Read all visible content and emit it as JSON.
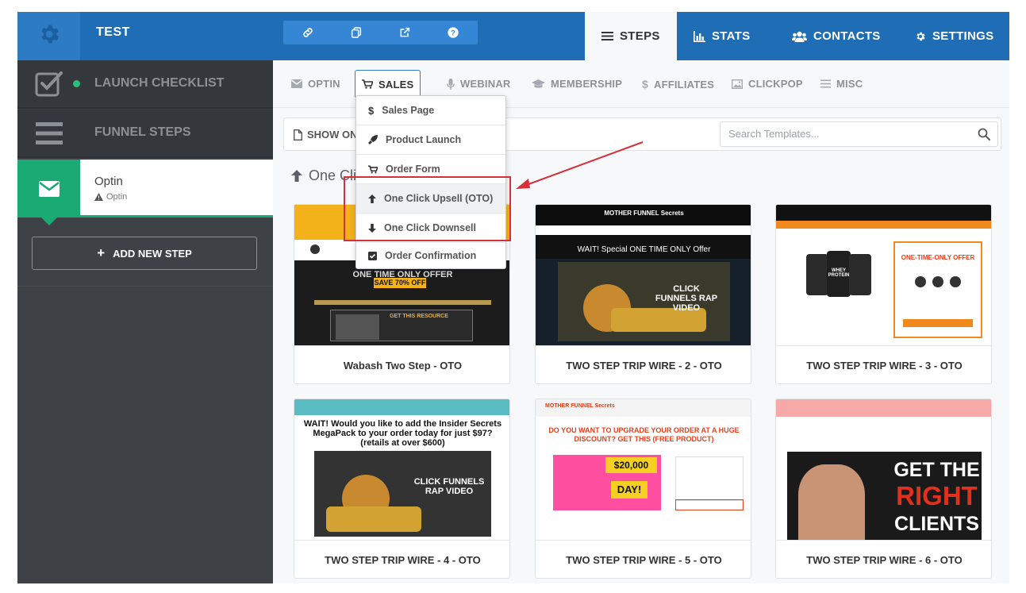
{
  "app": {
    "title": "TEST"
  },
  "nav_tabs": [
    {
      "label": "STEPS",
      "icon": "list-icon"
    },
    {
      "label": "STATS",
      "icon": "bar-chart-icon"
    },
    {
      "label": "CONTACTS",
      "icon": "users-icon"
    },
    {
      "label": "SETTINGS",
      "icon": "gear-icon"
    }
  ],
  "toolbar_icons": [
    "link-icon",
    "copy-icon",
    "external-link-icon",
    "help-icon"
  ],
  "sidebar": {
    "launch_checklist": "LAUNCH CHECKLIST",
    "funnel_steps": "FUNNEL STEPS",
    "step": {
      "name": "Optin",
      "sub": "Optin"
    },
    "add_step": "ADD NEW STEP"
  },
  "subnav": [
    {
      "label": "OPTIN",
      "icon": "envelope-icon"
    },
    {
      "label": "SALES",
      "icon": "cart-icon"
    },
    {
      "label": "WEBINAR",
      "icon": "microphone-icon"
    },
    {
      "label": "MEMBERSHIP",
      "icon": "graduation-cap-icon"
    },
    {
      "label": "AFFILIATES",
      "icon": "dollar-icon"
    },
    {
      "label": "CLICKPOP",
      "icon": "image-icon"
    },
    {
      "label": "MISC",
      "icon": "menu-icon"
    }
  ],
  "show_button": "SHOW ON",
  "search": {
    "placeholder": "Search Templates..."
  },
  "section_title": "One Click Upsells",
  "dropdown": [
    {
      "label": "Sales Page",
      "icon": "dollar-icon"
    },
    {
      "label": "Product Launch",
      "icon": "rocket-icon"
    },
    {
      "label": "Order Form",
      "icon": "cart-icon"
    },
    {
      "label": "One Click Upsell (OTO)",
      "icon": "arrow-up-icon"
    },
    {
      "label": "One Click Downsell",
      "icon": "arrow-down-icon"
    },
    {
      "label": "Order Confirmation",
      "icon": "check-square-icon"
    }
  ],
  "templates": [
    {
      "title": "Wabash Two Step - OTO",
      "thumb": {
        "headline": "ONE TIME ONLY OFFER",
        "sub": "SAVE 70% OFF",
        "note": "GET THIS RESOURCE"
      }
    },
    {
      "title": "TWO STEP TRIP WIRE - 2 - OTO",
      "thumb": {
        "brand": "MOTHER FUNNEL Secrets",
        "headline": "WAIT! Special ONE TIME ONLY Offer",
        "video": "CLICK FUNNELS RAP VIDEO"
      }
    },
    {
      "title": "TWO STEP TRIP WIRE - 3 - OTO",
      "thumb": {
        "headline": "ONE-TIME-ONLY OFFER",
        "product": "WHEY PROTEIN"
      }
    },
    {
      "title": "TWO STEP TRIP WIRE - 4 - OTO",
      "thumb": {
        "headline": "WAIT! Would you like to add the Insider Secrets MegaPack to your order today for just $97? (retails at over $600)",
        "video": "CLICK FUNNELS RAP VIDEO"
      }
    },
    {
      "title": "TWO STEP TRIP WIRE - 5 - OTO",
      "thumb": {
        "brand": "MOTHER FUNNEL Secrets",
        "headline": "DO YOU WANT TO UPGRADE YOUR ORDER AT A HUGE DISCOUNT? GET THIS (FREE PRODUCT)",
        "promo": "$20,000",
        "promo2": "DAY!"
      }
    },
    {
      "title": "TWO STEP TRIP WIRE - 6 - OTO",
      "thumb": {
        "headline": "GET THE",
        "headline2": "RIGHT",
        "headline3": "CLIENTS"
      }
    }
  ],
  "colors": {
    "primary": "#1f6db5",
    "green": "#1aaa73",
    "sidebar": "#3e4247",
    "highlight": "#d6303a"
  }
}
